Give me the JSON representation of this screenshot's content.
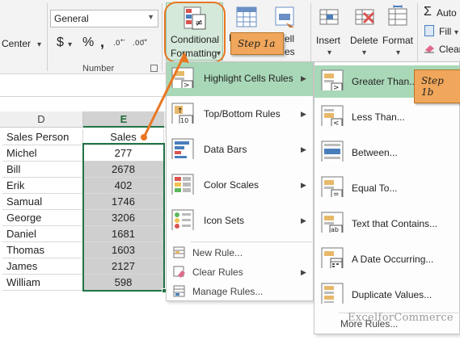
{
  "ribbon": {
    "alignment_label": "Center",
    "number_format_value": "General",
    "number_group_label": "Number",
    "currency_symbol": "$",
    "percent_symbol": "%",
    "comma_symbol": ",",
    "conditional_formatting_label_1": "Conditional",
    "conditional_formatting_label_2": "Formatting",
    "format_as_table_partial": "F",
    "cell_styles_partial_1": "ell",
    "cell_styles_partial_2": "es",
    "insert_label": "Insert",
    "delete_label": "Delete",
    "format_label": "Format",
    "autosum_label": "Auto",
    "fill_label": "Fill",
    "clear_label": "Clear"
  },
  "sheet": {
    "col_d": "D",
    "col_e": "E",
    "header_person": "Sales Person",
    "header_sales": "Sales",
    "rows": [
      {
        "name": "Michel",
        "sales": "277"
      },
      {
        "name": "Bill",
        "sales": "2678"
      },
      {
        "name": "Erik",
        "sales": "402"
      },
      {
        "name": "Samual",
        "sales": "1746"
      },
      {
        "name": "George",
        "sales": "3206"
      },
      {
        "name": "Daniel",
        "sales": "1681"
      },
      {
        "name": "Thomas",
        "sales": "1603"
      },
      {
        "name": "James",
        "sales": "2127"
      },
      {
        "name": "William",
        "sales": "598"
      }
    ]
  },
  "cf_menu": {
    "items": [
      {
        "label": "Highlight Cells Rules"
      },
      {
        "label": "Top/Bottom Rules"
      },
      {
        "label": "Data Bars"
      },
      {
        "label": "Color Scales"
      },
      {
        "label": "Icon Sets"
      },
      {
        "label": "New Rule..."
      },
      {
        "label": "Clear Rules"
      },
      {
        "label": "Manage Rules..."
      }
    ]
  },
  "submenu": {
    "items": [
      {
        "label": "Greater Than..."
      },
      {
        "label": "Less Than..."
      },
      {
        "label": "Between..."
      },
      {
        "label": "Equal To..."
      },
      {
        "label": "Text that Contains..."
      },
      {
        "label": "A Date Occurring..."
      },
      {
        "label": "Duplicate Values..."
      },
      {
        "label": "More Rules..."
      }
    ]
  },
  "callouts": {
    "step1a": "Step 1a",
    "step1b": "Step 1b"
  },
  "watermark": "ExcelforCommerce",
  "colors": {
    "highlight_green": "#a9d8b8",
    "callout_orange": "#f0a65b",
    "arrow_orange": "#e87722",
    "selected_border": "#217346"
  }
}
